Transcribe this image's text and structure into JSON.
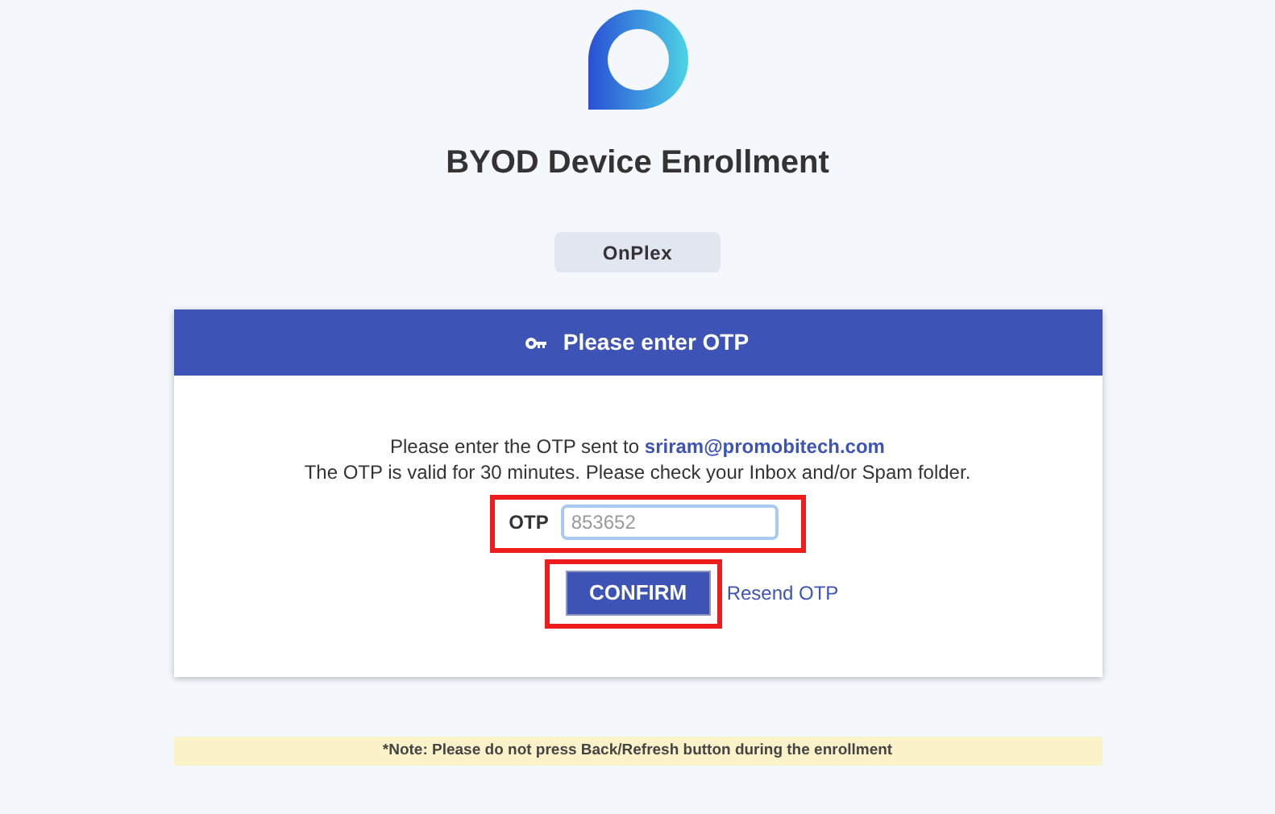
{
  "title": "BYOD Device Enrollment",
  "organization": "OnPlex",
  "card": {
    "header": "Please enter OTP",
    "message": {
      "text": "Please enter the OTP sent to ",
      "email": "sriram@promobitech.com"
    },
    "validity": "The OTP is valid for 30 minutes. Please check your Inbox and/or Spam folder.",
    "otp": {
      "label": "OTP",
      "placeholder": "853652",
      "highlighted": true
    },
    "confirm": {
      "label": "CONFIRM",
      "highlighted": true
    },
    "resend": "Resend OTP"
  },
  "note": "*Note: Please do not press Back/Refresh button during the enrollment"
}
